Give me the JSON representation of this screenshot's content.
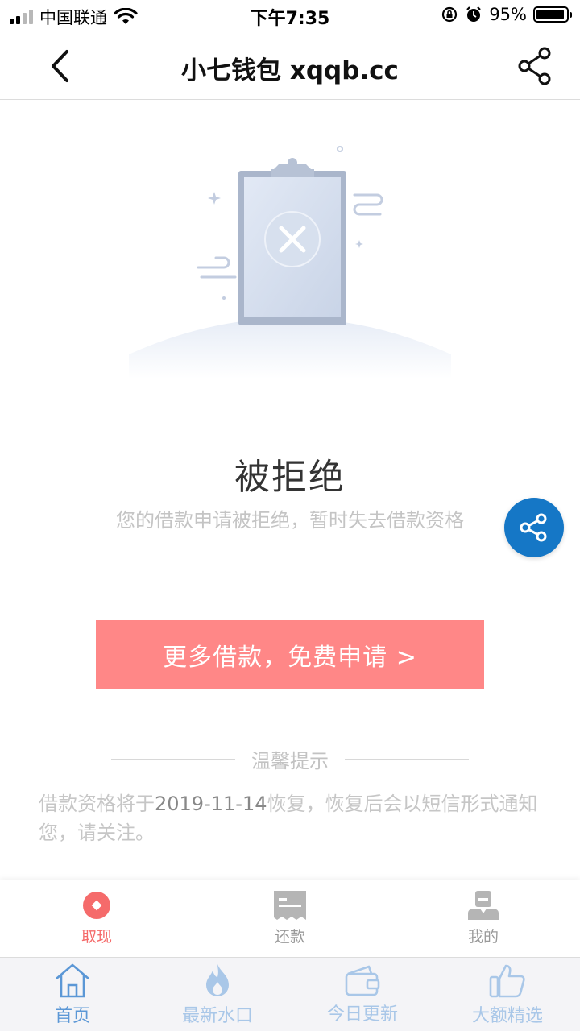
{
  "status_bar": {
    "carrier": "中国联通",
    "time": "下午7:35",
    "battery_percent": "95%",
    "battery_level": 0.95
  },
  "nav": {
    "title": "小七钱包 xqqb.cc",
    "back_icon": "chevron-left-icon",
    "share_icon": "share-icon"
  },
  "result": {
    "title": "被拒绝",
    "subtitle": "您的借款申请被拒绝，暂时失去借款资格"
  },
  "cta": {
    "label": "更多借款，免费申请 >"
  },
  "tips": {
    "heading": "温馨提示",
    "text_before": "借款资格将于",
    "date": "2019-11-14",
    "text_after": "恢复，恢复后会以短信形式通知您，请关注。"
  },
  "app_tabs": [
    {
      "label": "取现",
      "icon": "coin-icon",
      "active": true
    },
    {
      "label": "还款",
      "icon": "receipt-icon",
      "active": false
    },
    {
      "label": "我的",
      "icon": "user-icon",
      "active": false
    }
  ],
  "browser_tabs": [
    {
      "label": "首页",
      "icon": "home-icon",
      "active": true
    },
    {
      "label": "最新水口",
      "icon": "fire-icon",
      "active": false
    },
    {
      "label": "今日更新",
      "icon": "wallet-icon",
      "active": false
    },
    {
      "label": "大额精选",
      "icon": "thumbs-up-icon",
      "active": false
    }
  ],
  "colors": {
    "cta": "#ff8787",
    "float_share": "#1577c6",
    "active_tab": "#f56b6b",
    "browser_active": "#5b97d6"
  }
}
